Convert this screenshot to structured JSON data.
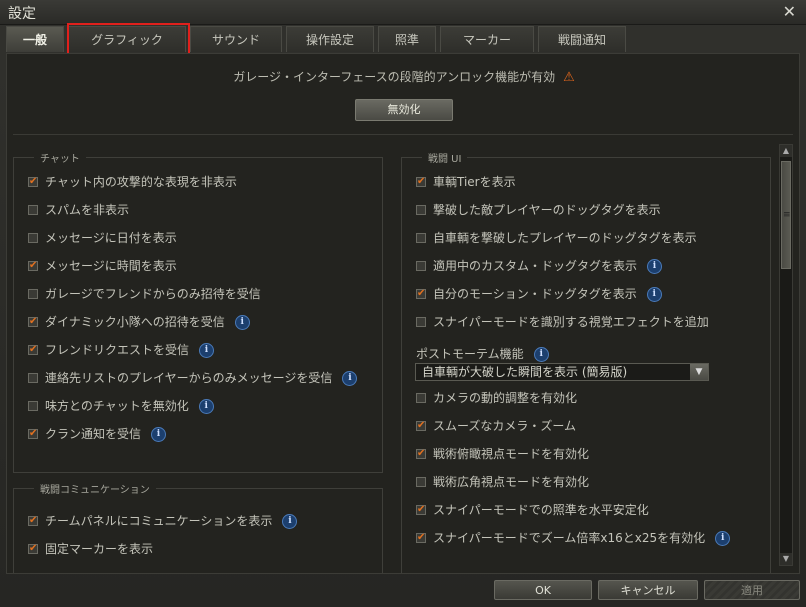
{
  "window": {
    "title": "設定"
  },
  "tabs": [
    {
      "label": "一般",
      "active": true
    },
    {
      "label": "グラフィック",
      "active": false
    },
    {
      "label": "サウンド",
      "active": false
    },
    {
      "label": "操作設定",
      "active": false
    },
    {
      "label": "照準",
      "active": false
    },
    {
      "label": "マーカー",
      "active": false
    },
    {
      "label": "戦闘通知",
      "active": false
    }
  ],
  "notice": {
    "text": "ガレージ・インターフェースの段階的アンロック機能が有効",
    "button_label": "無効化"
  },
  "chat": {
    "title": "チャット",
    "items": [
      {
        "label": "チャット内の攻撃的な表現を非表示",
        "checked": true,
        "info": false
      },
      {
        "label": "スパムを非表示",
        "checked": false,
        "info": false
      },
      {
        "label": "メッセージに日付を表示",
        "checked": false,
        "info": false
      },
      {
        "label": "メッセージに時間を表示",
        "checked": true,
        "info": false
      },
      {
        "label": "ガレージでフレンドからのみ招待を受信",
        "checked": false,
        "info": false
      },
      {
        "label": "ダイナミック小隊への招待を受信",
        "checked": true,
        "info": true
      },
      {
        "label": "フレンドリクエストを受信",
        "checked": true,
        "info": true
      },
      {
        "label": "連絡先リストのプレイヤーからのみメッセージを受信",
        "checked": false,
        "info": true
      },
      {
        "label": "味方とのチャットを無効化",
        "checked": false,
        "info": true
      },
      {
        "label": "クラン通知を受信",
        "checked": true,
        "info": true
      }
    ]
  },
  "battle_comm": {
    "title": "戦闘コミュニケーション",
    "items": [
      {
        "label": "チームパネルにコミュニケーションを表示",
        "checked": true,
        "info": true
      },
      {
        "label": "固定マーカーを表示",
        "checked": true,
        "info": false
      }
    ]
  },
  "battle_ui": {
    "title": "戦闘 UI",
    "items_top": [
      {
        "label": "車輌Tierを表示",
        "checked": true,
        "info": false
      },
      {
        "label": "撃破した敵プレイヤーのドッグタグを表示",
        "checked": false,
        "info": false
      },
      {
        "label": "自車輌を撃破したプレイヤーのドッグタグを表示",
        "checked": false,
        "info": false
      },
      {
        "label": "適用中のカスタム・ドッグタグを表示",
        "checked": false,
        "info": true
      },
      {
        "label": "自分のモーション・ドッグタグを表示",
        "checked": true,
        "info": true
      },
      {
        "label": "スナイパーモードを識別する視覚エフェクトを追加",
        "checked": false,
        "info": false
      }
    ],
    "postmortem_label": "ポストモーテム機能",
    "postmortem_value": "自車輌が大破した瞬間を表示 (簡易版)",
    "items_bottom": [
      {
        "label": "カメラの動的調整を有効化",
        "checked": false,
        "info": false
      },
      {
        "label": "スムーズなカメラ・ズーム",
        "checked": true,
        "info": false
      },
      {
        "label": "戦術俯瞰視点モードを有効化",
        "checked": true,
        "info": false
      },
      {
        "label": "戦術広角視点モードを有効化",
        "checked": false,
        "info": false
      },
      {
        "label": "スナイパーモードでの照準を水平安定化",
        "checked": true,
        "info": false
      },
      {
        "label": "スナイパーモードでズーム倍率x16とx25を有効化",
        "checked": true,
        "info": true
      }
    ]
  },
  "footer": {
    "ok": "OK",
    "cancel": "キャンセル",
    "apply": "適用"
  }
}
